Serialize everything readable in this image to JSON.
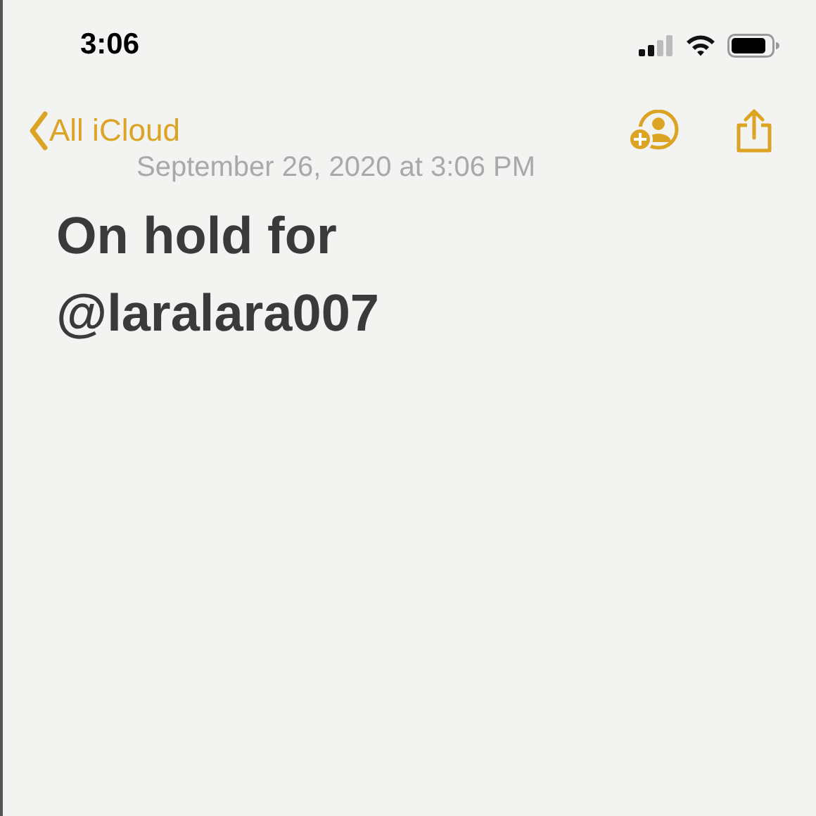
{
  "status_bar": {
    "time": "3:06"
  },
  "nav_bar": {
    "back_label": "All iCloud"
  },
  "note": {
    "date": "September 26, 2020 at 3:06 PM",
    "title_lines": [
      "On hold for",
      "@laralara007"
    ]
  }
}
